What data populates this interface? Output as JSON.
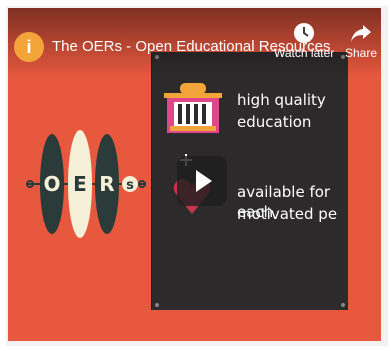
{
  "video": {
    "channel_icon_letter": "i",
    "title": "The OERs - Open Educational Resources",
    "watch_later_label": "Watch later",
    "share_label": "Share"
  },
  "slide": {
    "line1_a": "high quality",
    "line1_b": "education",
    "line2_a": "available for each",
    "line2_b": "motivated pe"
  },
  "logo": {
    "letters": [
      "O",
      "E",
      "R",
      "s"
    ]
  },
  "colors": {
    "background": "#e8583f",
    "board": "#2c2a2a",
    "channel_icon": "#f3a53a",
    "logo_dark": "#2b3b3a",
    "logo_cream": "#f6f0d8",
    "building_pink": "#e0468a"
  },
  "icons": [
    "clock-icon",
    "share-arrow-icon",
    "play-icon",
    "building-icon",
    "heart-icon"
  ]
}
